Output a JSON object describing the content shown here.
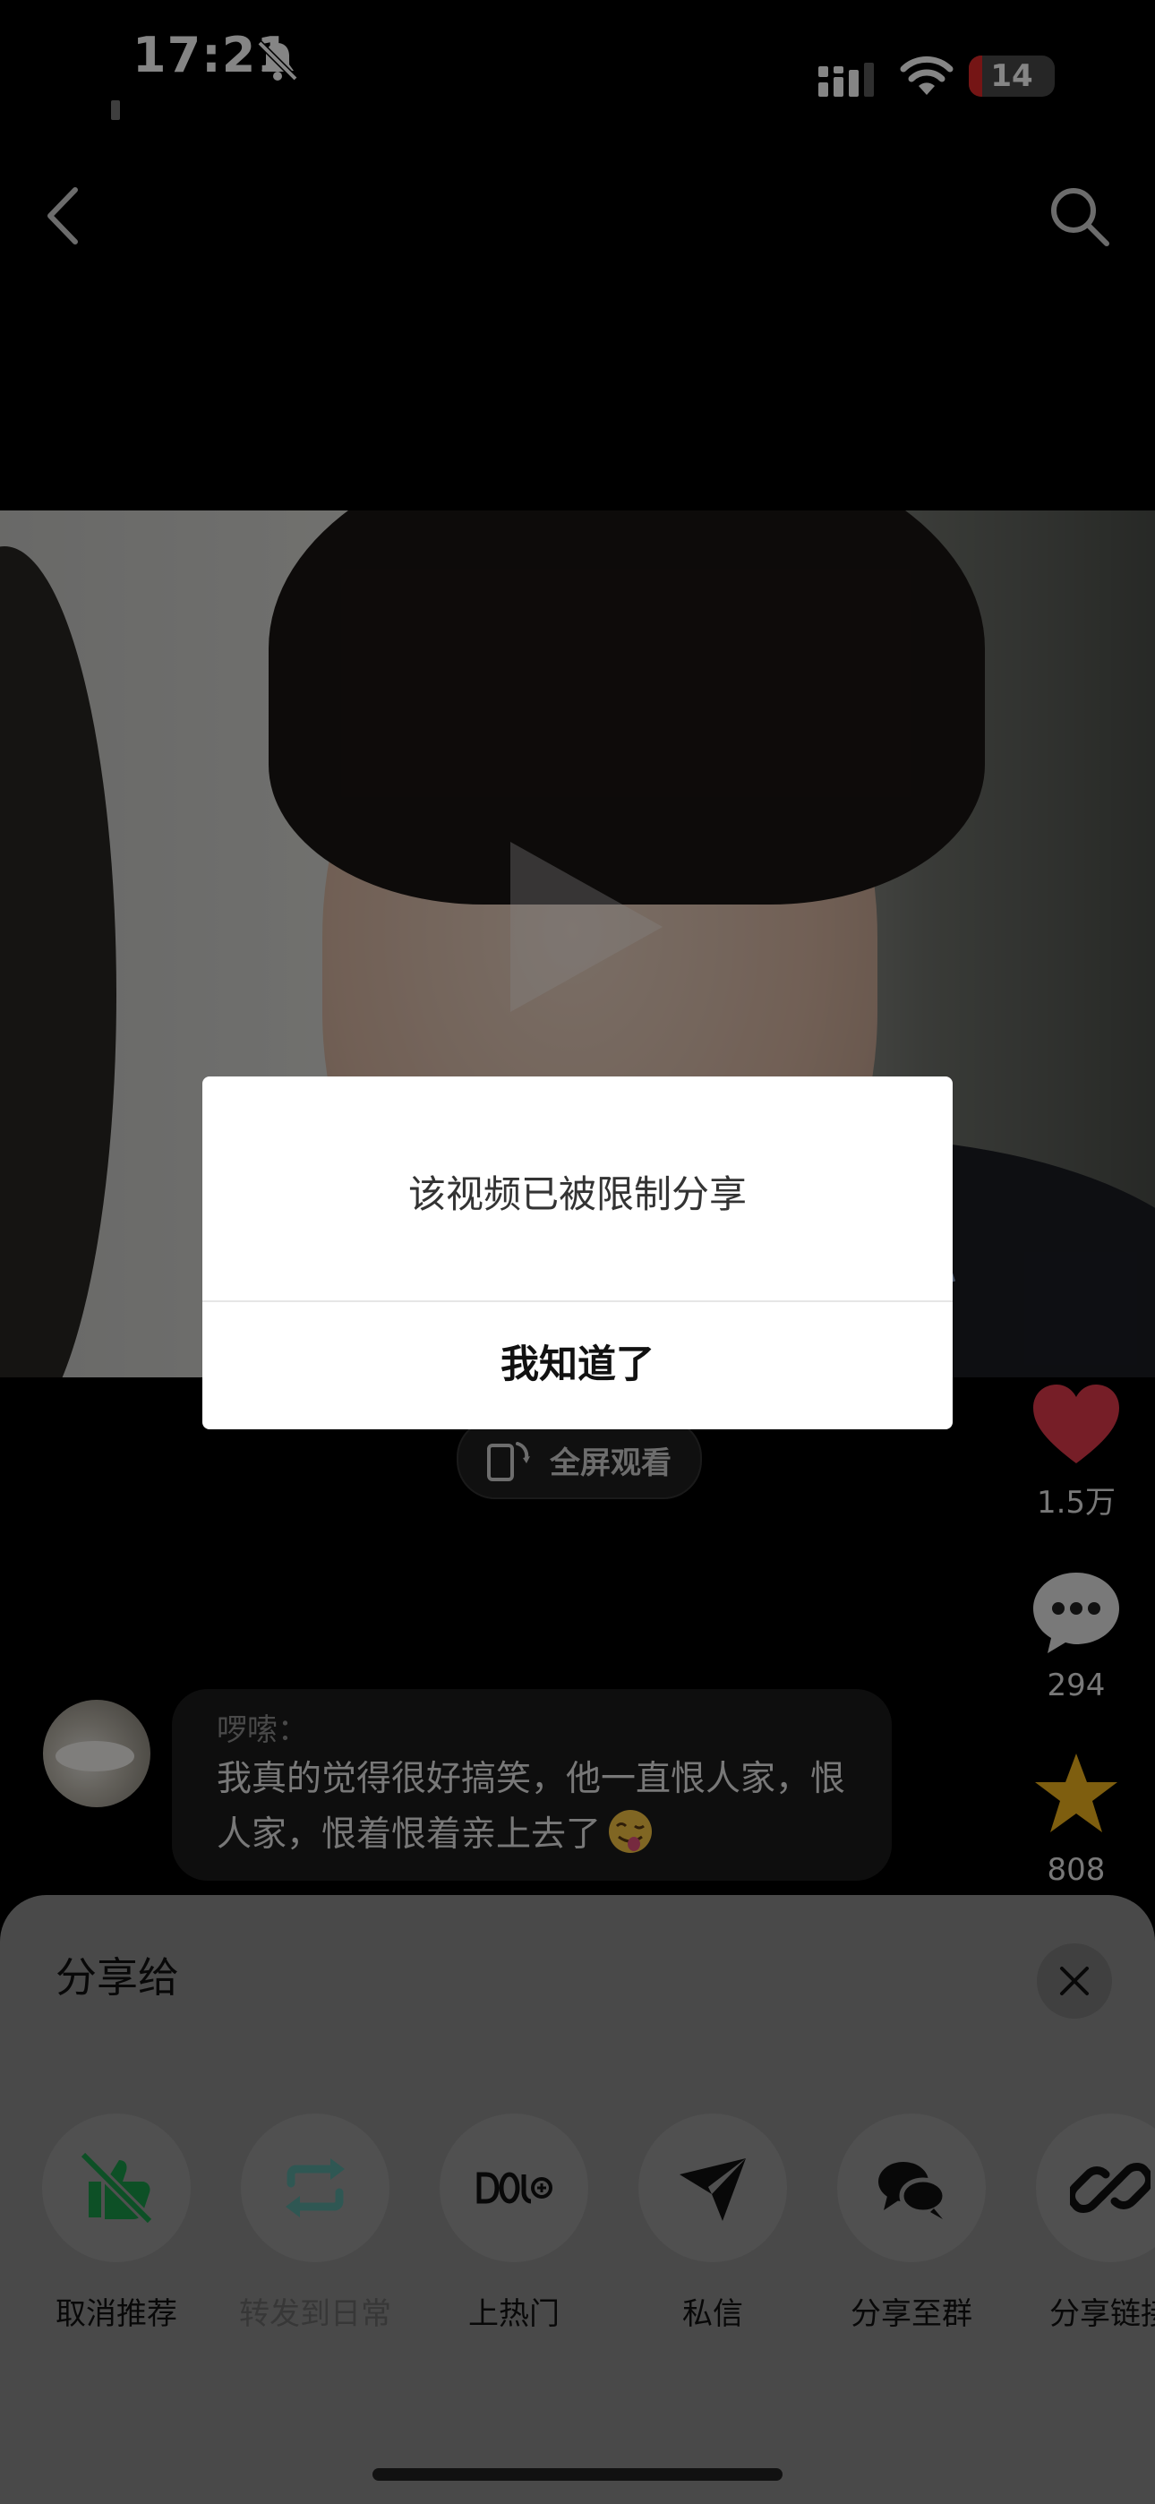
{
  "status_bar": {
    "time": "17:21",
    "battery_level": "14",
    "battery_color": "#e02a2a"
  },
  "icons": {
    "bell": "bell-slash-icon",
    "signal": "cellular-signal-icon",
    "wifi": "wifi-icon",
    "back": "chevron-left-icon",
    "search": "search-icon",
    "like": "heart-icon",
    "comment": "chat-bubble-icon",
    "favorite": "star-icon",
    "close": "close-icon"
  },
  "actions": {
    "like_count": "1.5万",
    "like_color": "#e33a4c",
    "comment_count": "294",
    "favorite_count": "808",
    "favorite_color": "#f2b51d",
    "fullscreen_label": "全屏观看"
  },
  "comment": {
    "author": "啰嗦：",
    "text": "我真的觉得很好搞笑，他一直恨人家，恨人家，恨着恨着亲上去了"
  },
  "dialog": {
    "message": "该视频已被限制分享",
    "confirm_label": "我知道了"
  },
  "share_sheet": {
    "title": "分享给",
    "items": [
      {
        "label": "取消推荐",
        "icon": "thumbs-down-slash-icon",
        "color": "#1a9a4a"
      },
      {
        "label": "转发到日常",
        "icon": "repost-icon",
        "color": "#5aa7a0"
      },
      {
        "label": "上热门",
        "icon": "dou-plus-icon",
        "color": "#111111"
      },
      {
        "label": "私信",
        "icon": "paper-plane-icon",
        "color": "#111111"
      },
      {
        "label": "分享至群",
        "icon": "group-chat-icon",
        "color": "#111111"
      },
      {
        "label": "分享链接",
        "icon": "link-icon",
        "color": "#111111"
      }
    ]
  }
}
